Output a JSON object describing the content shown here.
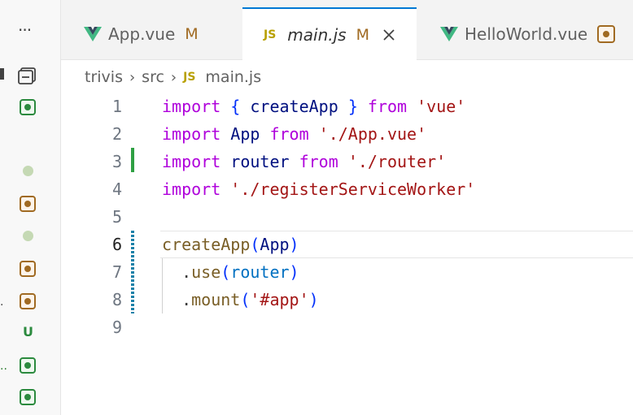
{
  "explorer": {
    "more_label": "···",
    "badges": [
      {
        "kind": "modified"
      },
      {
        "kind": "added"
      },
      {
        "kind": "dot"
      },
      {
        "kind": "modified"
      },
      {
        "kind": "dot"
      },
      {
        "kind": "modified"
      },
      {
        "kind": "modified"
      },
      {
        "kind": "untracked",
        "label": "U"
      },
      {
        "kind": "added"
      },
      {
        "kind": "added"
      }
    ],
    "truncated_marks": [
      ".",
      ".."
    ]
  },
  "tabs": [
    {
      "name": "App.vue",
      "icon": "vue-icon",
      "status": "M",
      "active": false
    },
    {
      "name": "main.js",
      "icon": "js-icon",
      "icon_label": "JS",
      "status": "M",
      "active": true
    },
    {
      "name": "HelloWorld.vue",
      "icon": "vue-icon",
      "status_icon": "modified-badge-icon",
      "active": false
    }
  ],
  "breadcrumb": {
    "items": [
      "trivis",
      "src",
      "main.js"
    ],
    "file_icon_label": "JS"
  },
  "editor": {
    "current_line": 6,
    "lines": [
      {
        "n": "1",
        "tokens": [
          [
            "kw",
            "import"
          ],
          [
            "punc",
            " "
          ],
          [
            "brace",
            "{"
          ],
          [
            "punc",
            " "
          ],
          [
            "var",
            "createApp"
          ],
          [
            "punc",
            " "
          ],
          [
            "brace",
            "}"
          ],
          [
            "punc",
            " "
          ],
          [
            "kw",
            "from"
          ],
          [
            "punc",
            " "
          ],
          [
            "str",
            "'vue'"
          ]
        ]
      },
      {
        "n": "2",
        "tokens": [
          [
            "kw",
            "import"
          ],
          [
            "punc",
            " "
          ],
          [
            "var",
            "App"
          ],
          [
            "punc",
            " "
          ],
          [
            "kw",
            "from"
          ],
          [
            "punc",
            " "
          ],
          [
            "str",
            "'./App.vue'"
          ]
        ]
      },
      {
        "n": "3",
        "tokens": [
          [
            "kw",
            "import"
          ],
          [
            "punc",
            " "
          ],
          [
            "var",
            "router"
          ],
          [
            "punc",
            " "
          ],
          [
            "kw",
            "from"
          ],
          [
            "punc",
            " "
          ],
          [
            "str",
            "'./router'"
          ]
        ]
      },
      {
        "n": "4",
        "tokens": [
          [
            "kw",
            "import"
          ],
          [
            "punc",
            " "
          ],
          [
            "str",
            "'./registerServiceWorker'"
          ]
        ]
      },
      {
        "n": "5",
        "tokens": []
      },
      {
        "n": "6",
        "tokens": [
          [
            "fn",
            "createApp"
          ],
          [
            "paren",
            "("
          ],
          [
            "var",
            "App"
          ],
          [
            "paren",
            ")"
          ]
        ]
      },
      {
        "n": "7",
        "tokens": [
          [
            "punc",
            "  ."
          ],
          [
            "prop",
            "use"
          ],
          [
            "paren",
            "("
          ],
          [
            "param",
            "router"
          ],
          [
            "paren",
            ")"
          ]
        ]
      },
      {
        "n": "8",
        "tokens": [
          [
            "punc",
            "  ."
          ],
          [
            "prop",
            "mount"
          ],
          [
            "paren",
            "("
          ],
          [
            "str",
            "'#app'"
          ],
          [
            "paren",
            ")"
          ]
        ]
      },
      {
        "n": "9",
        "tokens": []
      }
    ]
  },
  "colors": {
    "accent": "#0078d4",
    "modified": "#a06a22",
    "added": "#2b8a3e",
    "keyword": "#af00db",
    "string": "#a31515"
  }
}
